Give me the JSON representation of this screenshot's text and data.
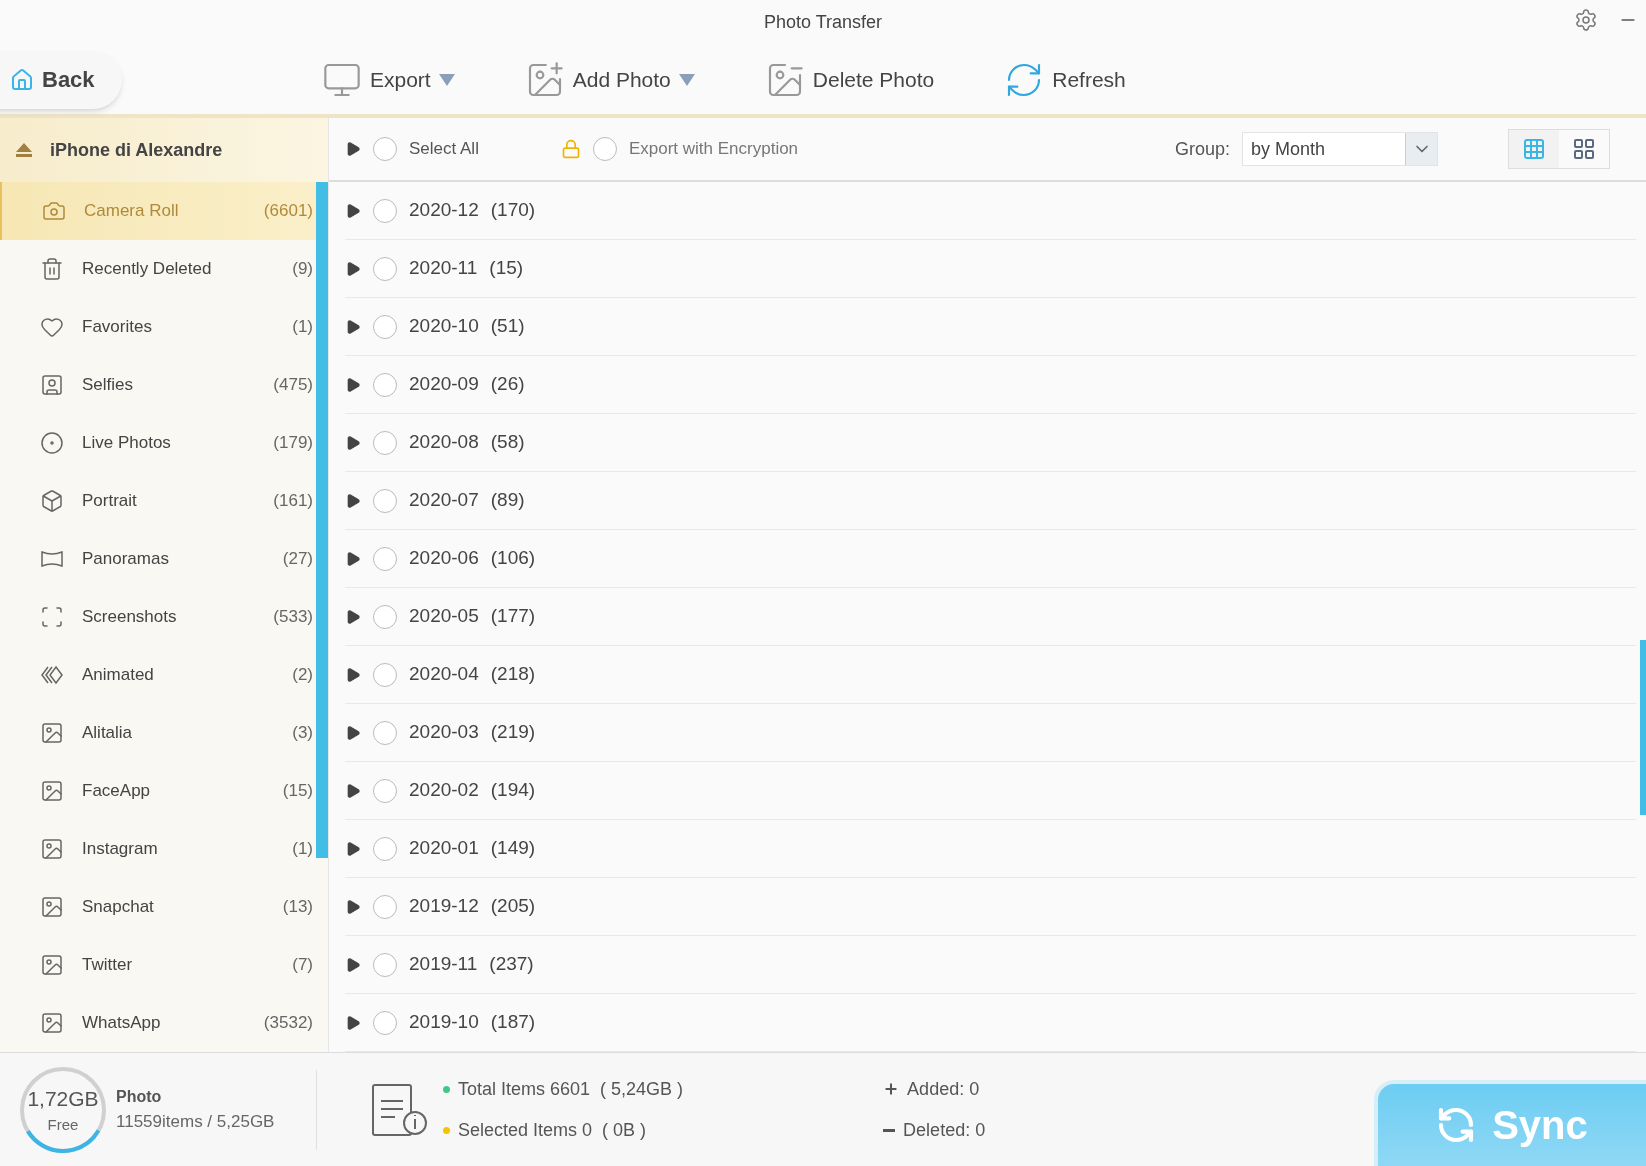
{
  "window": {
    "title": "Photo Transfer"
  },
  "back_button": "Back",
  "toolbar": [
    {
      "label": "Export",
      "kind": "export",
      "dropdown": true
    },
    {
      "label": "Add Photo",
      "kind": "add",
      "dropdown": true
    },
    {
      "label": "Delete Photo",
      "kind": "delete",
      "dropdown": false
    },
    {
      "label": "Refresh",
      "kind": "refresh",
      "dropdown": false
    }
  ],
  "device": {
    "name": "iPhone di Alexandre"
  },
  "sidebar": {
    "items": [
      {
        "label": "Camera Roll",
        "count": "(6601)",
        "kind": "camera",
        "selected": true
      },
      {
        "label": "Recently Deleted",
        "count": "(9)",
        "kind": "trash",
        "selected": false
      },
      {
        "label": "Favorites",
        "count": "(1)",
        "kind": "heart",
        "selected": false
      },
      {
        "label": "Selfies",
        "count": "(475)",
        "kind": "selfie",
        "selected": false
      },
      {
        "label": "Live Photos",
        "count": "(179)",
        "kind": "live",
        "selected": false
      },
      {
        "label": "Portrait",
        "count": "(161)",
        "kind": "cube",
        "selected": false
      },
      {
        "label": "Panoramas",
        "count": "(27)",
        "kind": "panorama",
        "selected": false
      },
      {
        "label": "Screenshots",
        "count": "(533)",
        "kind": "screenshot",
        "selected": false
      },
      {
        "label": "Animated",
        "count": "(2)",
        "kind": "animated",
        "selected": false
      },
      {
        "label": "Alitalia",
        "count": "(3)",
        "kind": "album",
        "selected": false
      },
      {
        "label": "FaceApp",
        "count": "(15)",
        "kind": "album",
        "selected": false
      },
      {
        "label": "Instagram",
        "count": "(1)",
        "kind": "album",
        "selected": false
      },
      {
        "label": "Snapchat",
        "count": "(13)",
        "kind": "album",
        "selected": false
      },
      {
        "label": "Twitter",
        "count": "(7)",
        "kind": "album",
        "selected": false
      },
      {
        "label": "WhatsApp",
        "count": "(3532)",
        "kind": "album",
        "selected": false
      }
    ]
  },
  "list_header": {
    "select_all": {
      "label": "Select All",
      "checked": false
    },
    "encryption": {
      "label": "Export with Encryption",
      "checked": false
    },
    "group_label": "Group:",
    "group_value": "by Month",
    "views": [
      {
        "kind": "small",
        "selected": true
      },
      {
        "kind": "large",
        "selected": false
      }
    ]
  },
  "groups": [
    {
      "month": "2020-12",
      "count": "(170)",
      "checked": false
    },
    {
      "month": "2020-11",
      "count": "(15)",
      "checked": false
    },
    {
      "month": "2020-10",
      "count": "(51)",
      "checked": false
    },
    {
      "month": "2020-09",
      "count": "(26)",
      "checked": false
    },
    {
      "month": "2020-08",
      "count": "(58)",
      "checked": false
    },
    {
      "month": "2020-07",
      "count": "(89)",
      "checked": false
    },
    {
      "month": "2020-06",
      "count": "(106)",
      "checked": false
    },
    {
      "month": "2020-05",
      "count": "(177)",
      "checked": false
    },
    {
      "month": "2020-04",
      "count": "(218)",
      "checked": false
    },
    {
      "month": "2020-03",
      "count": "(219)",
      "checked": false
    },
    {
      "month": "2020-02",
      "count": "(194)",
      "checked": false
    },
    {
      "month": "2020-01",
      "count": "(149)",
      "checked": false
    },
    {
      "month": "2019-12",
      "count": "(205)",
      "checked": false
    },
    {
      "month": "2019-11",
      "count": "(237)",
      "checked": false
    },
    {
      "month": "2019-10",
      "count": "(187)",
      "checked": false
    }
  ],
  "footer": {
    "storage": {
      "free": "1,72GB",
      "free_label": "Free",
      "level": 0.33,
      "type": "Photo",
      "detail": "11559items / 5,25GB"
    },
    "total": "Total Items 6601  ( 5,24GB )",
    "selected": "Selected Items 0  ( 0B )",
    "added": "Added: 0",
    "deleted": "Deleted: 0",
    "sync": "Sync"
  }
}
